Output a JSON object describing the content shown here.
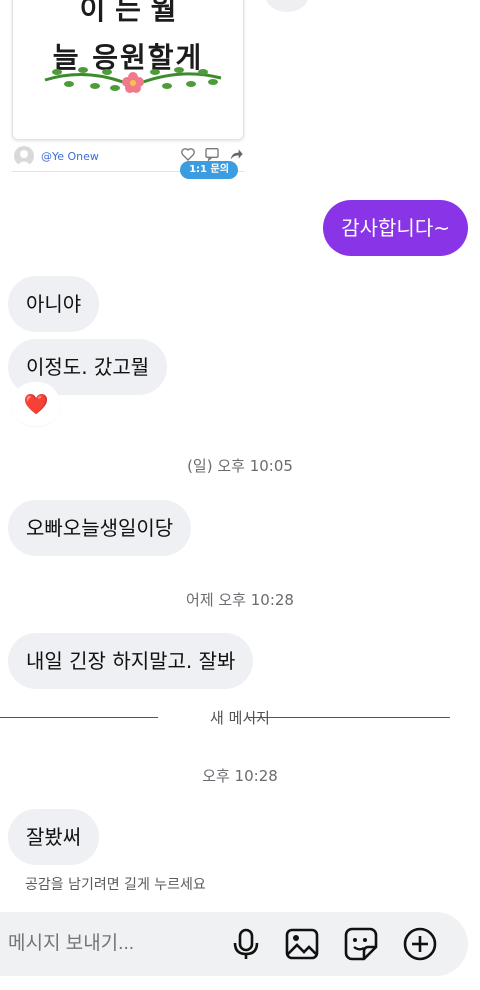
{
  "shared_post": {
    "top_text": "이 는 월",
    "main_text": "늘 응원할게",
    "username": "@Ye Onew",
    "badge": "1:1 문의"
  },
  "messages": [
    {
      "id": "m1",
      "direction": "outgoing",
      "text": "감사합니다~"
    },
    {
      "id": "m2",
      "direction": "incoming",
      "text": "아니야"
    },
    {
      "id": "m3",
      "direction": "incoming",
      "text": "이정도. 갔고뭘",
      "reaction": "❤️"
    },
    {
      "id": "m4",
      "direction": "incoming",
      "text": "오빠오늘생일이당"
    },
    {
      "id": "m5",
      "direction": "incoming",
      "text": "내일 긴장 하지말고. 잘봐"
    },
    {
      "id": "m6",
      "direction": "incoming",
      "text": "잘봤써"
    }
  ],
  "timestamps": {
    "t1": "(일) 오후 10:05",
    "t2": "어제 오후 10:28",
    "t3": "오후 10:28"
  },
  "new_messages_divider": "새 메시지",
  "reaction_hint": "공감을 남기려면 길게 누르세요",
  "composer": {
    "placeholder": "메시지 보내기...",
    "icons": [
      "microphone-icon",
      "image-icon",
      "sticker-icon",
      "add-icon"
    ]
  }
}
